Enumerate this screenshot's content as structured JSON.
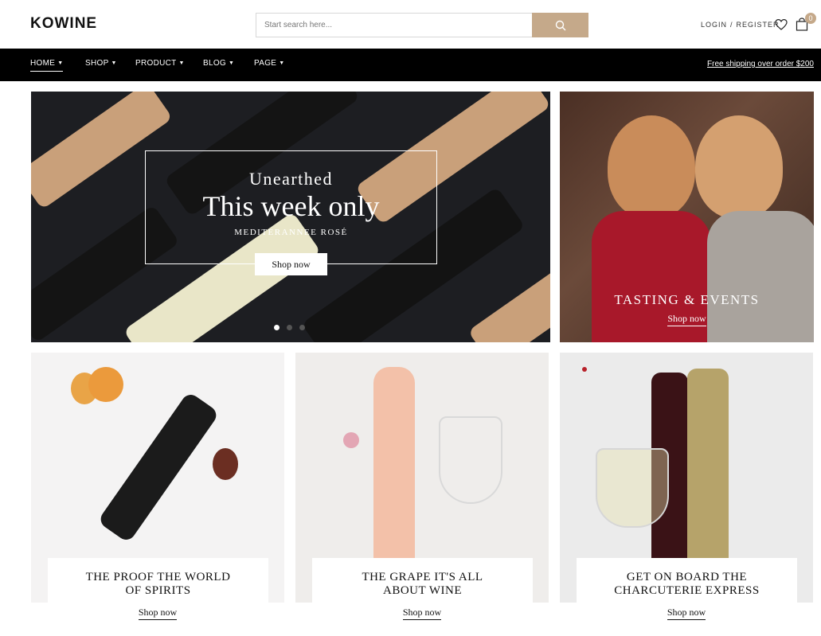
{
  "header": {
    "logo": "KOWINE",
    "search_placeholder": "Start search here...",
    "login": "LOGIN",
    "separator": "/",
    "register": "REGISTER",
    "cart_count": "0"
  },
  "nav": {
    "items": [
      {
        "label": "HOME"
      },
      {
        "label": "SHOP"
      },
      {
        "label": "PRODUCT"
      },
      {
        "label": "BLOG"
      },
      {
        "label": "PAGE"
      }
    ],
    "shipping": "Free shipping over order $200"
  },
  "hero": {
    "subtitle": "Unearthed",
    "title": "This week only",
    "tagline": "MEDITERANNEE ROSÉ",
    "button": "Shop now",
    "slides_active": 1,
    "slides_total": 3
  },
  "side_banner": {
    "title": "TASTING & EVENTS",
    "link": "Shop now"
  },
  "cards": [
    {
      "title_line1": "THE PROOF THE WORLD",
      "title_line2": "OF SPIRITS",
      "link": "Shop now"
    },
    {
      "title_line1": "THE GRAPE IT'S ALL",
      "title_line2": "ABOUT WINE",
      "link": "Shop now"
    },
    {
      "title_line1": "GET ON BOARD THE",
      "title_line2": "CHARCUTERIE EXPRESS",
      "link": "Shop now"
    }
  ],
  "colors": {
    "accent": "#c5a98a",
    "nav_bg": "#000000"
  }
}
